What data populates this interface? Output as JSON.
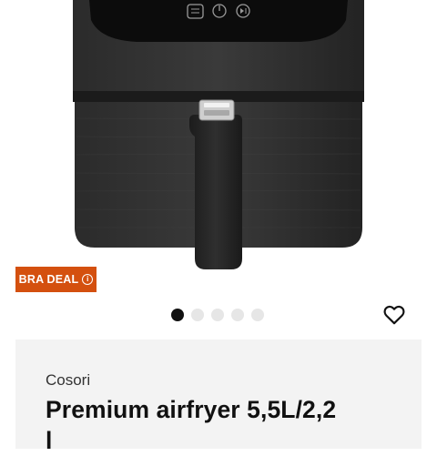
{
  "product": {
    "badge_label": "BRA DEAL",
    "badge_info_glyph": "i",
    "brand": "Cosori",
    "title_line1": "Premium airfryer 5,5L/2,2",
    "title_line2": "l"
  },
  "gallery": {
    "image_count": 5,
    "active_index": 0
  },
  "colors": {
    "badge_bg": "#d4500f",
    "card_bg": "#f3f3f3",
    "dot_active": "#111111",
    "dot_inactive": "#e6e6e6"
  },
  "icons": {
    "favorite": "heart-outline-icon"
  }
}
